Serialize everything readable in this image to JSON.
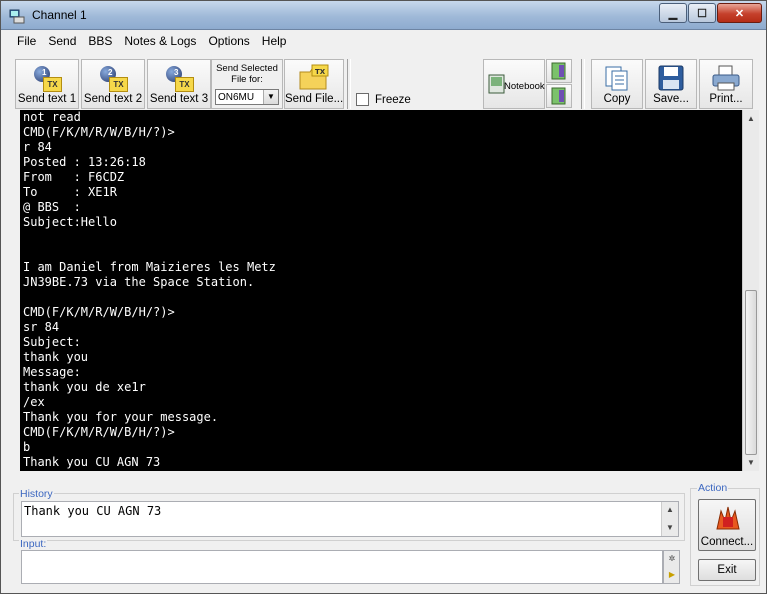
{
  "window": {
    "title": "Channel 1"
  },
  "menu": [
    "File",
    "Send",
    "BBS",
    "Notes & Logs",
    "Options",
    "Help"
  ],
  "toolbar": {
    "send_text_1": "Send text 1",
    "send_text_2": "Send text 2",
    "send_text_3": "Send text 3",
    "send_selected_label": "Send Selected File for:",
    "send_selected_value": "ON6MU",
    "send_file": "Send File...",
    "freeze": "Freeze",
    "notebook": "Notebook",
    "copy": "Copy",
    "save": "Save...",
    "print": "Print..."
  },
  "terminal": {
    "lines": [
      "not read",
      "CMD(F/K/M/R/W/B/H/?)>",
      "r 84",
      "Posted : 13:26:18",
      "From   : F6CDZ",
      "To     : XE1R",
      "@ BBS  :",
      "Subject:Hello",
      "",
      "",
      "I am Daniel from Maizieres les Metz",
      "JN39BE.73 via the Space Station.",
      "",
      "CMD(F/K/M/R/W/B/H/?)>",
      "sr 84",
      "Subject:",
      "thank you",
      "Message:",
      "thank you de xe1r",
      "/ex",
      "Thank you for your message.",
      "CMD(F/K/M/R/W/B/H/?)>",
      "b",
      "Thank you CU AGN 73"
    ]
  },
  "history": {
    "label": "History",
    "text": "Thank you CU AGN 73"
  },
  "input": {
    "label": "Input:",
    "value": ""
  },
  "action": {
    "label": "Action",
    "connect": "Connect...",
    "exit": "Exit"
  }
}
